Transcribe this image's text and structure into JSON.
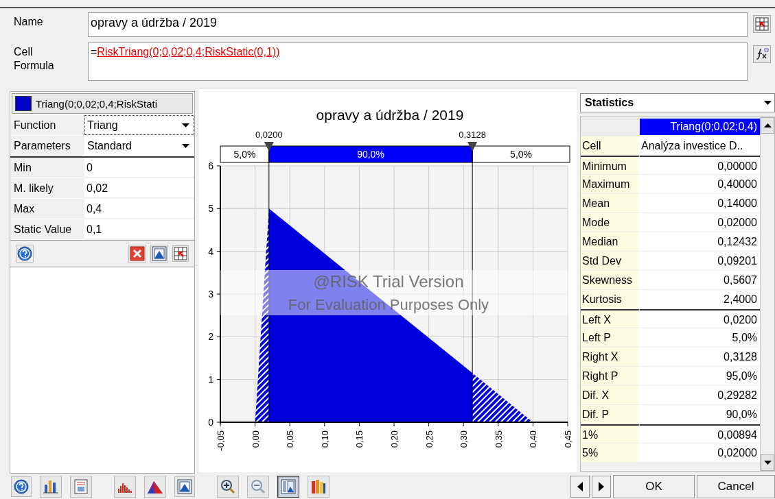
{
  "name": {
    "label": "Name",
    "value": "opravy a údržba / 2019"
  },
  "formula": {
    "label": "Cell Formula",
    "prefix": "=",
    "function": "RiskTriang(0;0,02;0,4;RiskStatic(0,1))"
  },
  "distribution": {
    "title": "Triang(0;0,02;0,4;RiskStati",
    "color": "#0000c8",
    "selectors": [
      {
        "label": "Function",
        "value": "Triang",
        "focused": true
      },
      {
        "label": "Parameters",
        "value": "Standard",
        "focused": false
      }
    ],
    "parameters": [
      {
        "label": "Min",
        "value": "0"
      },
      {
        "label": "M. likely",
        "value": "0,02"
      },
      {
        "label": "Max",
        "value": "0,4"
      },
      {
        "label": "Static Value",
        "value": "0,1"
      }
    ]
  },
  "delimiter_bar": {
    "segments": [
      {
        "label": "5,0%",
        "selected": false
      },
      {
        "label": "90,0%",
        "selected": true
      },
      {
        "label": "5,0%",
        "selected": false
      }
    ]
  },
  "chart_data": {
    "type": "area",
    "title": "opravy a údržba / 2019",
    "x": [
      -0.05,
      0,
      0.02,
      0.3128,
      0.4,
      0.45
    ],
    "series": [
      {
        "color": "#0000dd",
        "values": [
          0,
          0,
          5,
          null,
          null,
          null
        ]
      },
      {
        "color": "#0000dd",
        "values": [
          null,
          null,
          5,
          1.15,
          null,
          null
        ]
      },
      {
        "color": "#0000dd",
        "values": [
          null,
          null,
          null,
          1.15,
          0,
          0
        ]
      }
    ],
    "xlim": [
      -0.05,
      0.45
    ],
    "ylim": [
      0,
      6
    ],
    "xticks": [
      {
        "value": -0.05,
        "label": "-0,05"
      },
      {
        "value": 0,
        "label": "0,00"
      },
      {
        "value": 0.05,
        "label": "0,05"
      },
      {
        "value": 0.1,
        "label": "0,10"
      },
      {
        "value": 0.15,
        "label": "0,15"
      },
      {
        "value": 0.2,
        "label": "0,20"
      },
      {
        "value": 0.25,
        "label": "0,25"
      },
      {
        "value": 0.3,
        "label": "0,30"
      },
      {
        "value": 0.35,
        "label": "0,35"
      },
      {
        "value": 0.4,
        "label": "0,40"
      },
      {
        "value": 0.45,
        "label": "0,45"
      }
    ],
    "yticks": [
      0,
      1,
      2,
      3,
      4,
      5,
      6
    ],
    "grid": true,
    "ref_lines": [
      {
        "axis": "x",
        "value": 0.02,
        "label": "0,0200"
      },
      {
        "axis": "x",
        "value": 0.3128,
        "label": "0,3128"
      }
    ]
  },
  "watermark": [
    "@RISK Trial Version",
    "For Evaluation Purposes Only"
  ],
  "statistics": {
    "dropdown": "Statistics",
    "column": {
      "label": "Triang(0;0,02;0,4)",
      "selected": true
    },
    "sections": [
      [
        {
          "label": "Cell",
          "value": "Analýza investice D.."
        }
      ],
      [
        {
          "label": "Minimum",
          "value": "0,00000"
        },
        {
          "label": "Maximum",
          "value": "0,40000"
        },
        {
          "label": "Mean",
          "value": "0,14000"
        },
        {
          "label": "Mode",
          "value": "0,02000"
        },
        {
          "label": "Median",
          "value": "0,12432"
        },
        {
          "label": "Std Dev",
          "value": "0,09201"
        },
        {
          "label": "Skewness",
          "value": "0,5607"
        },
        {
          "label": "Kurtosis",
          "value": "2,4000"
        }
      ],
      [
        {
          "label": "Left X",
          "value": "0,0200"
        },
        {
          "label": "Left P",
          "value": "5,0%"
        },
        {
          "label": "Right X",
          "value": "0,3128"
        },
        {
          "label": "Right P",
          "value": "95,0%"
        },
        {
          "label": "Dif. X",
          "value": "0,29282"
        },
        {
          "label": "Dif. P",
          "value": "90,0%"
        }
      ],
      [
        {
          "label": "1%",
          "value": "0,00894"
        },
        {
          "label": "5%",
          "value": "0,02000"
        }
      ]
    ]
  },
  "toolbar": [
    {
      "pressed": false
    },
    {
      "pressed": false
    },
    {
      "pressed": false
    },
    {
      "pressed": false
    },
    {
      "pressed": false
    },
    {
      "pressed": false
    },
    {
      "pressed": false
    },
    {
      "pressed": false
    },
    {
      "pressed": true
    },
    {
      "pressed": false
    }
  ],
  "buttons": [
    "OK",
    "Cancel"
  ]
}
